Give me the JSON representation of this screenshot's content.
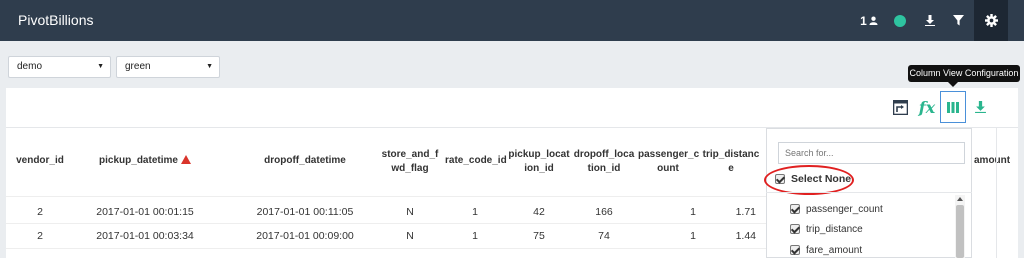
{
  "app": {
    "title": "PivotBillions"
  },
  "topbar": {
    "user_count": "1",
    "icons": [
      "user-icon",
      "status-dot-icon",
      "download-icon",
      "filter-icon",
      "gear-icon"
    ],
    "status_color": "#2ec4a0"
  },
  "filters": {
    "dataset_select": "demo",
    "table_select": "green"
  },
  "toolbar": {
    "tooltip": "Column View Configuration",
    "fx_label": "fx",
    "buttons": [
      "export-icon",
      "formula-fx-icon",
      "columns-icon",
      "download-icon"
    ]
  },
  "table": {
    "columns": [
      {
        "label": "vendor_id"
      },
      {
        "label": "pickup_datetime",
        "sorted": "asc"
      },
      {
        "label": "dropoff_datetime"
      },
      {
        "label": "store_and_fwd_flag",
        "lines": [
          "store_and_f",
          "wd_flag"
        ]
      },
      {
        "label": "rate_code_id"
      },
      {
        "label": "pickup_location_id",
        "lines": [
          "pickup_locat",
          "ion_id"
        ]
      },
      {
        "label": "dropoff_location_id",
        "lines": [
          "dropoff_loca",
          "tion_id"
        ]
      },
      {
        "label": "passenger_count",
        "lines": [
          "passenger_c",
          "ount"
        ]
      },
      {
        "label": "trip_distance",
        "lines": [
          "trip_distanc",
          "e"
        ]
      },
      {
        "label": "amount"
      }
    ],
    "rows": [
      [
        "2",
        "2017-01-01 00:01:15",
        "2017-01-01 00:11:05",
        "N",
        "1",
        "42",
        "166",
        "1",
        "1.71"
      ],
      [
        "2",
        "2017-01-01 00:03:34",
        "2017-01-01 00:09:00",
        "N",
        "1",
        "75",
        "74",
        "1",
        "1.44"
      ]
    ]
  },
  "column_config": {
    "search_placeholder": "Search for...",
    "select_none_label": "Select None",
    "items": [
      {
        "label": "passenger_count",
        "checked": true
      },
      {
        "label": "trip_distance",
        "checked": true
      },
      {
        "label": "fare_amount",
        "checked": true
      }
    ]
  }
}
